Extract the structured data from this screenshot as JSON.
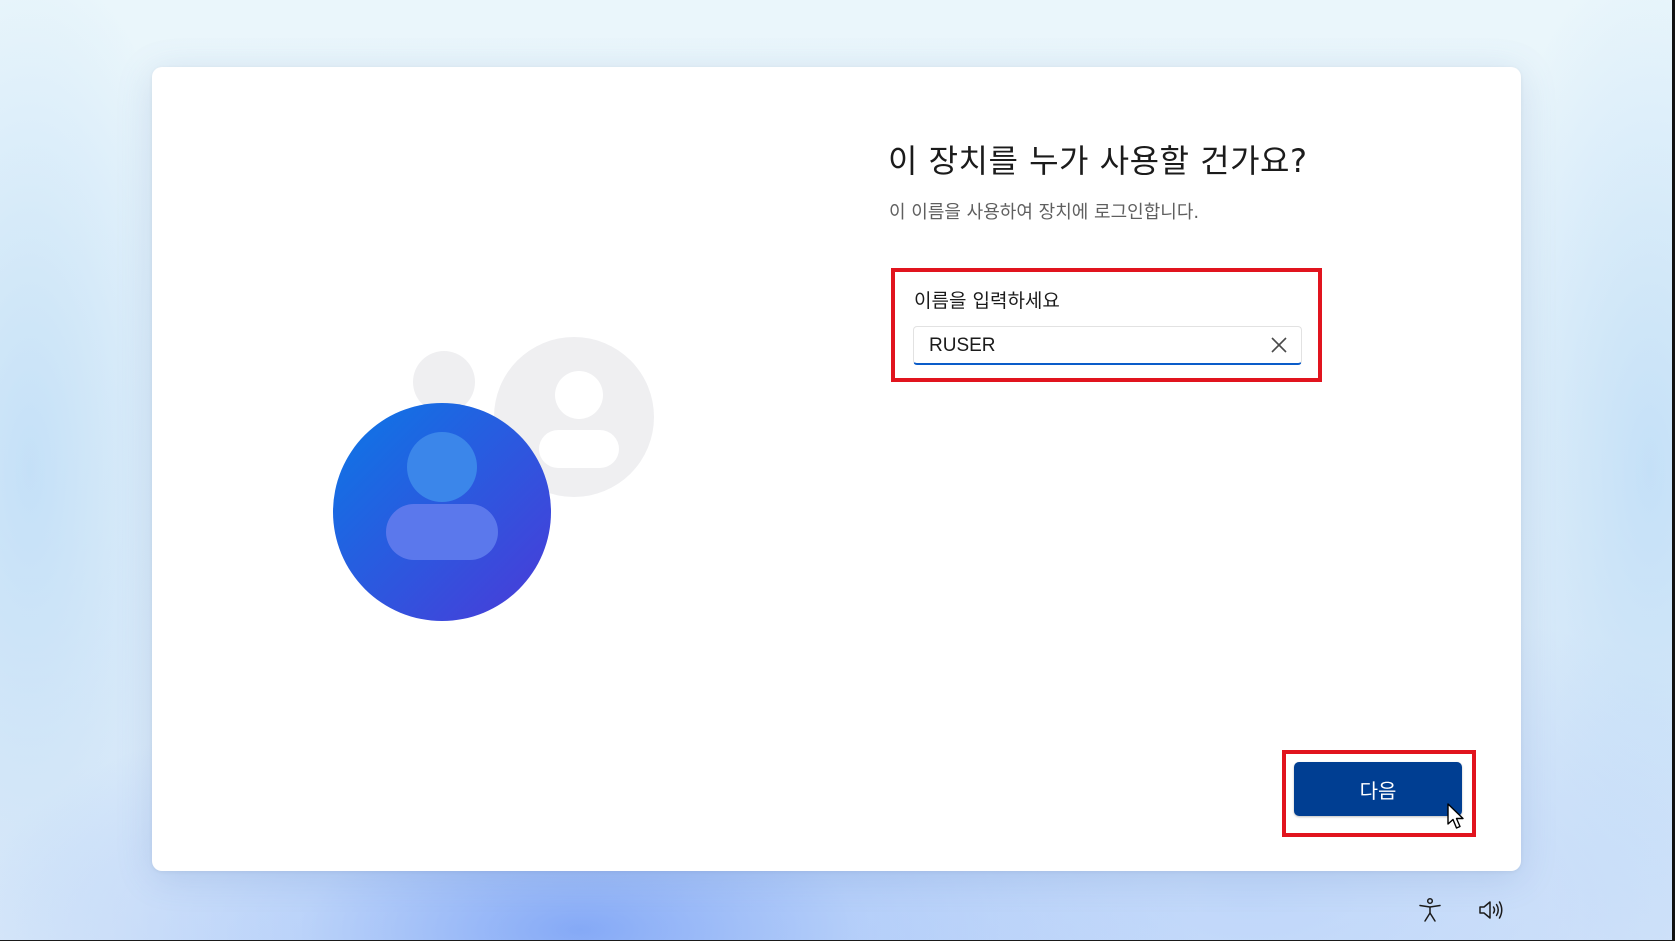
{
  "setup": {
    "title": "이 장치를 누가 사용할 건가요?",
    "subtitle": "이 이름을 사용하여 장치에 로그인합니다.",
    "name_field": {
      "label": "이름을 입력하세요",
      "value": "RUSER"
    },
    "next_button": "다음"
  },
  "icons": {
    "illustration": "user-accounts-illustration",
    "clear": "close-icon",
    "accessibility": "accessibility-icon",
    "volume": "volume-icon",
    "cursor": "mouse-pointer-icon"
  },
  "colors": {
    "primary_button": "#003e92",
    "input_focus_underline": "#0a5cc9",
    "highlight_box": "#e1141e",
    "avatar_gradient_start": "#0b78e6",
    "avatar_gradient_end": "#4b3ad8"
  }
}
